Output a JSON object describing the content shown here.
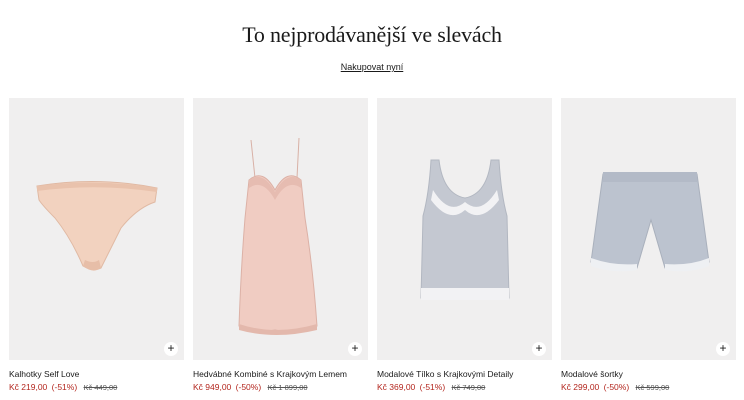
{
  "header": {
    "title": "To nejprodávanější ve slevách",
    "shop_link": "Nakupovat nyní"
  },
  "products": [
    {
      "name": "Kalhotky Self Love",
      "sale_price": "Kč 219,00",
      "discount": "(-51%)",
      "original_price": "Kč 449,00",
      "image_icon": "panties-icon",
      "color": "#f2d2bf"
    },
    {
      "name": "Hedvábné Kombiné s Krajkovým Lemem",
      "sale_price": "Kč 949,00",
      "discount": "(-50%)",
      "original_price": "Kč 1 899,00",
      "image_icon": "slip-dress-icon",
      "color": "#f0ccc2"
    },
    {
      "name": "Modalové Tílko s Krajkovými Detaily",
      "sale_price": "Kč 369,00",
      "discount": "(-51%)",
      "original_price": "Kč 749,00",
      "image_icon": "camisole-icon",
      "color": "#c4c8d1"
    },
    {
      "name": "Modalové šortky",
      "sale_price": "Kč 299,00",
      "discount": "(-50%)",
      "original_price": "Kč 599,00",
      "image_icon": "shorts-icon",
      "color": "#bcc3cf"
    }
  ],
  "add_icon": "+",
  "colors": {
    "sale": "#b3261e",
    "card_bg": "#f0efef"
  }
}
